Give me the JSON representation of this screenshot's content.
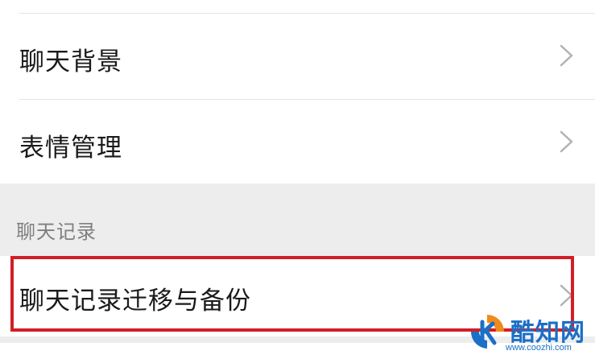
{
  "settings_list": {
    "items": [
      {
        "label": "聊天背景"
      },
      {
        "label": "表情管理"
      }
    ]
  },
  "chat_history_section": {
    "header": "聊天记录",
    "items": [
      {
        "label": "聊天记录迁移与备份"
      }
    ]
  },
  "watermark": {
    "name": "酷知网",
    "url": "www.coozhi.com"
  },
  "icons": {
    "row_arrow": "chevron-right-icon",
    "watermark_logo": "coozhi-logo-icon"
  },
  "colors": {
    "highlight_border": "#d21f26",
    "page_background": "#ededed",
    "row_background": "#ffffff",
    "watermark_text": "#1b6fc7",
    "watermark_orange": "#f08a1c"
  }
}
